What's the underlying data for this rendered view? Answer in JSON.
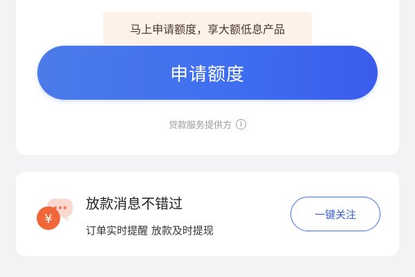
{
  "loan_card": {
    "promo_tag": "马上申请额度，享大额低息产品",
    "apply_button": "申请额度",
    "provider_text": "贷款服务提供方",
    "info_icon_glyph": "i"
  },
  "notification_card": {
    "title": "放款消息不错过",
    "subtitle": "订单实时提醒 放款及时提现",
    "follow_button": "一键关注",
    "icon_glyph": "¥"
  },
  "colors": {
    "primary_blue": "#3f6ff0",
    "promo_bg": "#fdf1e8",
    "coin_orange": "#f0683a",
    "page_bg": "#f2f3f5"
  },
  "icons": [
    "info-icon",
    "yuan-coin-chat-icon"
  ]
}
